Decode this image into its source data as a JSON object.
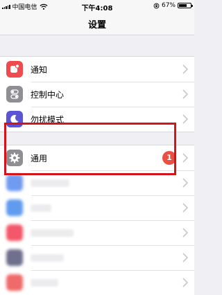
{
  "status_bar": {
    "carrier": "中国电信",
    "time": "下午4:08",
    "battery_percent": "67%",
    "battery_level": 0.67
  },
  "nav": {
    "title": "设置"
  },
  "group1": [
    {
      "label": "通知",
      "icon": "notifications-icon",
      "color": "#ef4a4d"
    },
    {
      "label": "控制中心",
      "icon": "control-center-icon",
      "color": "#8e8e93"
    },
    {
      "label": "勿扰模式",
      "icon": "moon-icon",
      "color": "#5b55d6"
    }
  ],
  "general": {
    "label": "通用",
    "icon": "gear-icon",
    "badge": "1",
    "color": "#8e8e93"
  },
  "blurred_colors": [
    "#6f9bf0",
    "#5f9bef",
    "#f3576a",
    "#6f6f8e",
    "#ef6a6a"
  ]
}
